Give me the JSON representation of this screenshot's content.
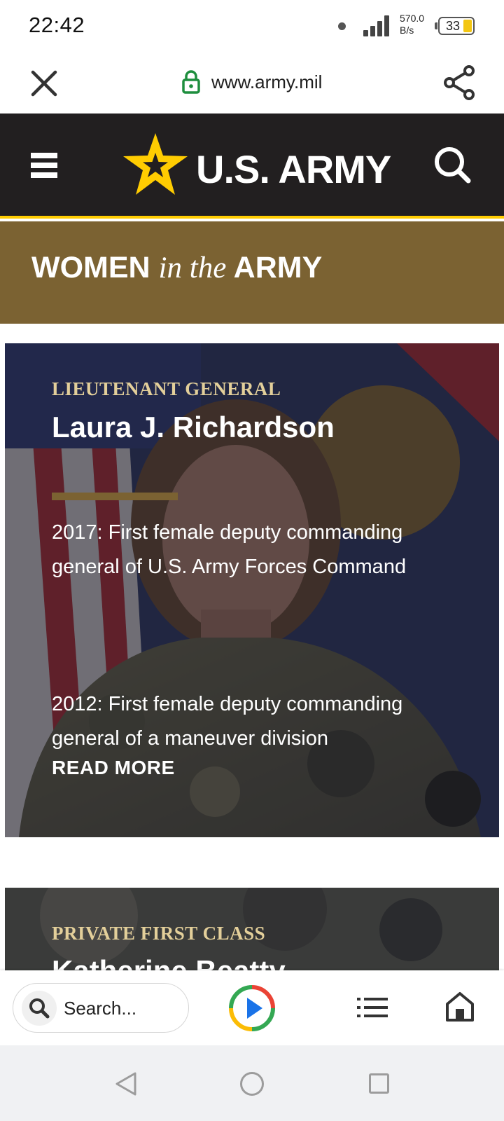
{
  "status_bar": {
    "time": "22:42",
    "net_speed_value": "570.0",
    "net_speed_unit": "B/s",
    "battery_level": "33",
    "icons": [
      "dot-icon",
      "signal-icon",
      "battery-icon"
    ]
  },
  "browser": {
    "url": "www.army.mil",
    "icons": [
      "close-icon",
      "lock-icon",
      "share-icon"
    ]
  },
  "site_header": {
    "title": "U.S. ARMY",
    "icons": [
      "menu-icon",
      "army-star-logo",
      "search-icon"
    ],
    "colors": {
      "background": "#221f20",
      "accent": "#ffcc01"
    }
  },
  "banner": {
    "word1": "WOMEN",
    "word2": "in the",
    "word3": "ARMY",
    "color": "#7b6232"
  },
  "feature": {
    "rank": "LIEUTENANT GENERAL",
    "name": "Laura J. Richardson",
    "milestones": [
      "2017: First female deputy commanding general of U.S. Army Forces Command",
      "2012: First female deputy commanding general of a maneuver division"
    ],
    "read_more": "READ MORE",
    "rank_color": "#e3cf9a"
  },
  "next_feature": {
    "rank": "PRIVATE FIRST CLASS",
    "name": "Katherine Beatty"
  },
  "bottom_toolbar": {
    "search_placeholder": "Search...",
    "icons": [
      "search-icon",
      "play-icon",
      "list-icon",
      "home-icon"
    ]
  },
  "nav_bar": {
    "icons": [
      "back-icon",
      "home-circle-icon",
      "recents-icon"
    ]
  }
}
